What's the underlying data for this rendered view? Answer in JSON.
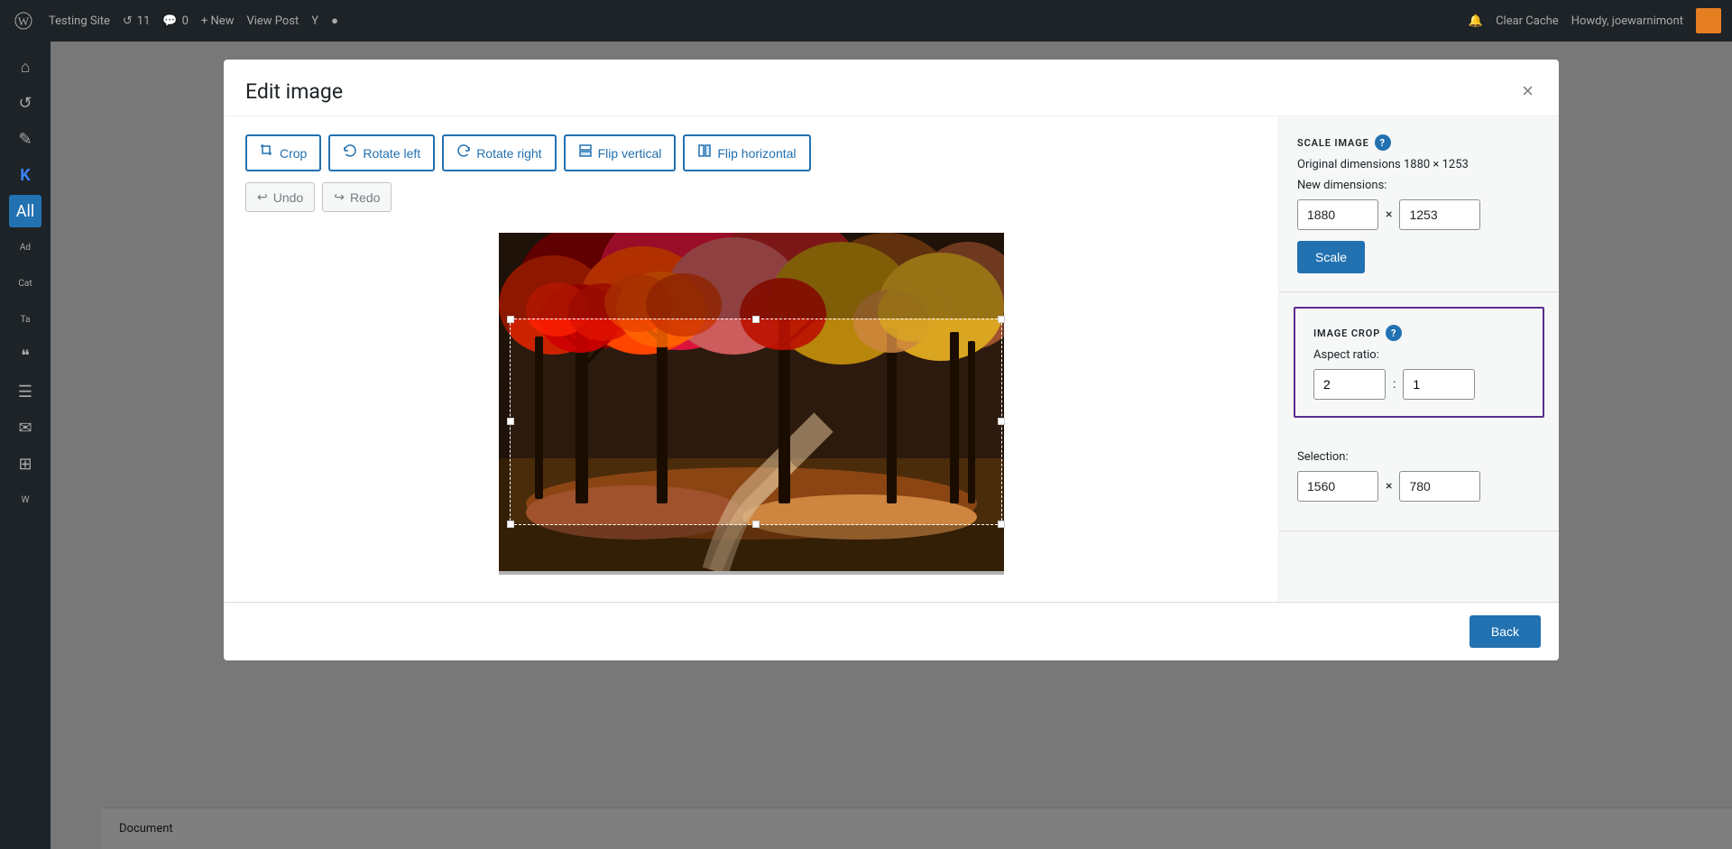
{
  "adminBar": {
    "siteName": "Testing Site",
    "updateCount": "11",
    "commentCount": "0",
    "newLabel": "+ New",
    "viewPost": "View Post",
    "clearCache": "Clear Cache",
    "howdy": "Howdy, joewarnimont"
  },
  "modal": {
    "title": "Edit image",
    "closeIcon": "×",
    "toolbar": {
      "cropLabel": "Crop",
      "rotateLeftLabel": "Rotate left",
      "rotateRightLabel": "Rotate right",
      "flipVerticalLabel": "Flip vertical",
      "flipHorizontalLabel": "Flip horizontal",
      "undoLabel": "Undo",
      "redoLabel": "Redo"
    },
    "rightPanel": {
      "scaleSection": {
        "title": "SCALE IMAGE",
        "originalDimensions": "Original dimensions 1880 × 1253",
        "newDimensionsLabel": "New dimensions:",
        "widthValue": "1880",
        "heightValue": "1253",
        "separatorScale": "×",
        "scaleButtonLabel": "Scale"
      },
      "cropSection": {
        "title": "IMAGE CROP",
        "aspectRatioLabel": "Aspect ratio:",
        "aspectWidth": "2",
        "aspectHeight": "1",
        "separatorAspect": ":",
        "selectionLabel": "Selection:",
        "selectionWidth": "1560",
        "selectionHeight": "780",
        "separatorSelection": "×"
      }
    },
    "footer": {
      "backButtonLabel": "Back"
    }
  },
  "sidebar": {
    "items": [
      {
        "icon": "⌂",
        "label": "Home"
      },
      {
        "icon": "↺",
        "label": "Updates"
      },
      {
        "icon": "✎",
        "label": "Posts"
      },
      {
        "icon": "K",
        "label": "Kadence"
      },
      {
        "icon": "★",
        "label": "All"
      },
      {
        "icon": "A",
        "label": "Add"
      },
      {
        "icon": "C",
        "label": "Cat"
      },
      {
        "icon": "T",
        "label": "Tags"
      },
      {
        "icon": "❝",
        "label": ""
      },
      {
        "icon": "☰",
        "label": ""
      },
      {
        "icon": "✉",
        "label": ""
      },
      {
        "icon": "⊞",
        "label": ""
      },
      {
        "icon": "W",
        "label": "Woo"
      }
    ]
  },
  "bottomBar": {
    "documentLabel": "Document"
  }
}
